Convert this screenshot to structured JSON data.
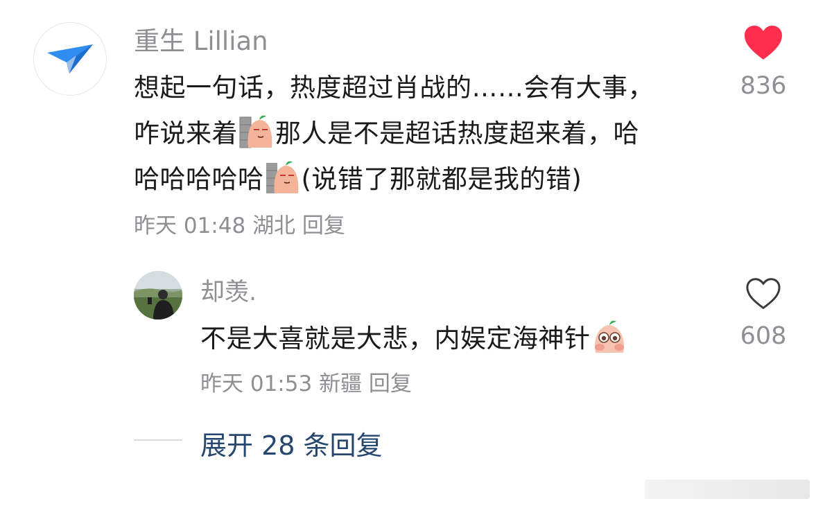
{
  "comment": {
    "username": "重生 Lillian",
    "text": {
      "line1": "想起一句话，热度超过肖战的……会有大事，",
      "line2a": "咋说来着",
      "line2b": "那人是不是超话热度超来着，哈",
      "line3a": "哈哈哈哈哈",
      "line3b": "(说错了那就都是我的错)"
    },
    "meta": {
      "time": "昨天 01:48",
      "location": "湖北",
      "reply": "回复"
    },
    "like_count": "836",
    "liked": true,
    "avatar_icon": "paper-plane-icon",
    "emoji_icon": "smug-peach-sticker-icon"
  },
  "reply": {
    "username": "却羡.",
    "text": "不是大喜就是大悲，内娱定海神针",
    "emoji_icon": "teary-eyes-peach-sticker-icon",
    "meta": {
      "time": "昨天 01:53",
      "location": "新疆",
      "reply": "回复"
    },
    "like_count": "608",
    "liked": false
  },
  "expand_replies": "展开 28 条回复",
  "colors": {
    "like_red": "#ff2e4d",
    "link_blue": "#25466e",
    "meta_gray": "#8e8e93"
  }
}
